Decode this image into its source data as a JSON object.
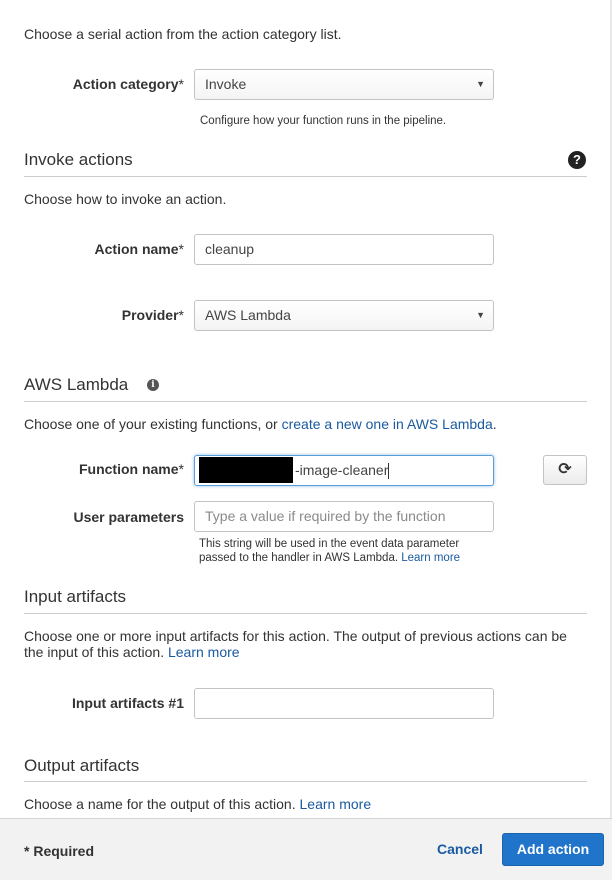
{
  "intro": "Choose a serial action from the action category list.",
  "action_category": {
    "label": "Action category",
    "required_mark": "*",
    "value": "Invoke",
    "help": "Configure how your function runs in the pipeline."
  },
  "invoke_section": {
    "title": "Invoke actions",
    "help_icon": "?",
    "description": "Choose how to invoke an action."
  },
  "action_name": {
    "label": "Action name",
    "required_mark": "*",
    "value": "cleanup"
  },
  "provider": {
    "label": "Provider",
    "required_mark": "*",
    "value": "AWS Lambda"
  },
  "lambda_section": {
    "title": "AWS Lambda",
    "info_icon": "i",
    "description_prefix": "Choose one of your existing functions, or ",
    "description_link": "create a new one in AWS Lambda",
    "description_suffix": "."
  },
  "function_name": {
    "label": "Function name",
    "required_mark": "*",
    "value_visible": "-image-cleaner"
  },
  "user_parameters": {
    "label": "User parameters",
    "placeholder": "Type a value if required by the function",
    "help_line1": "This string will be used in the event data parameter",
    "help_line2": "passed to the handler in AWS Lambda.",
    "help_link": "Learn more"
  },
  "input_section": {
    "title": "Input artifacts",
    "description_line1": "Choose one or more input artifacts for this action. The output of previous actions can be",
    "description_line2": "the input of this action.",
    "description_link": "Learn more"
  },
  "input_artifacts": {
    "label": "Input artifacts #1",
    "value": ""
  },
  "output_section": {
    "title": "Output artifacts",
    "description": "Choose a name for the output of this action.",
    "description_link": "Learn more"
  },
  "footer": {
    "required_note": "* Required",
    "cancel_label": "Cancel",
    "add_action_label": "Add action"
  },
  "colors": {
    "primary_button": "#2074c9",
    "link": "#1a5aa0",
    "focus_border": "#5b9dd9"
  },
  "icons": {
    "dropdown": "caret-down-icon",
    "help": "question-circle-icon",
    "info": "info-circle-icon",
    "refresh": "refresh-icon"
  }
}
